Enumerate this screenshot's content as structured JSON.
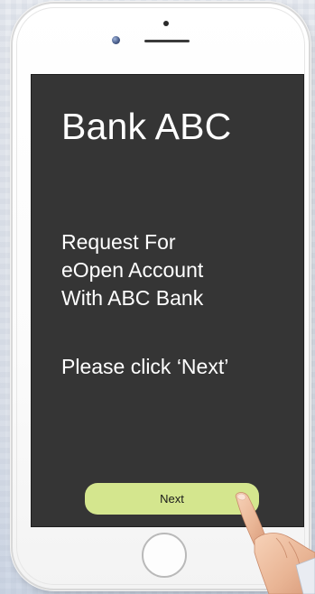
{
  "screen": {
    "title": "Bank ABC",
    "request_lines": [
      "Request For",
      "eOpen Account",
      "With ABC Bank"
    ],
    "instruction": "Please click ‘Next’",
    "next_label": "Next"
  },
  "icons": {
    "camera": "front-camera-icon",
    "speaker": "earpiece-speaker-icon",
    "home": "home-button-icon",
    "hand": "pointing-hand-icon"
  },
  "colors": {
    "screen_background": "#353535",
    "button": "#d4e68e",
    "text": "#ffffff"
  }
}
